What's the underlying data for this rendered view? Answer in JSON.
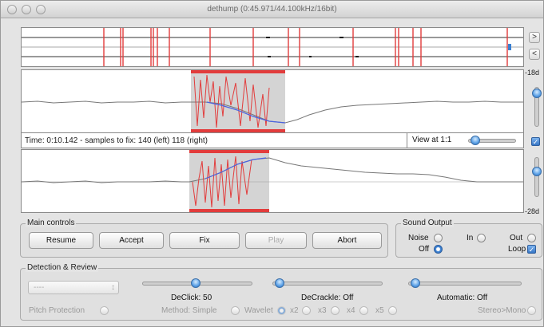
{
  "window": {
    "title": "dethump (0:45.971/44.100kHz/16bit)"
  },
  "side": {
    "next_label": ">",
    "prev_label": "<",
    "db_top": "-18d",
    "db_bottom": "-28d"
  },
  "info": {
    "time_text": "Time: 0:10.142 - samples to fix: 140 (left) 118 (right)",
    "view_label": "View at 1:1"
  },
  "main_controls": {
    "title": "Main controls",
    "resume": "Resume",
    "accept": "Accept",
    "fix": "Fix",
    "play": "Play",
    "abort": "Abort"
  },
  "sound_output": {
    "title": "Sound Output",
    "noise": "Noise",
    "in": "In",
    "out": "Out",
    "off": "Off",
    "loop": "Loop"
  },
  "detection": {
    "title": "Detection & Review",
    "select_value": "----",
    "pitch_protection": "Pitch Protection",
    "declick": "DeClick: 50",
    "decrackle": "DeCrackle: Off",
    "automatic": "Automatic: Off",
    "method": "Method: Simple",
    "wavelet": "Wavelet",
    "x2": "x2",
    "x3": "x3",
    "x4": "x4",
    "x5": "x5",
    "stereo_mono": "Stereo>Mono"
  },
  "colors": {
    "accent": "#3a7fd0",
    "marker": "#e23c3c",
    "selection": "#d4d4d4",
    "curve": "#4a63e0"
  }
}
